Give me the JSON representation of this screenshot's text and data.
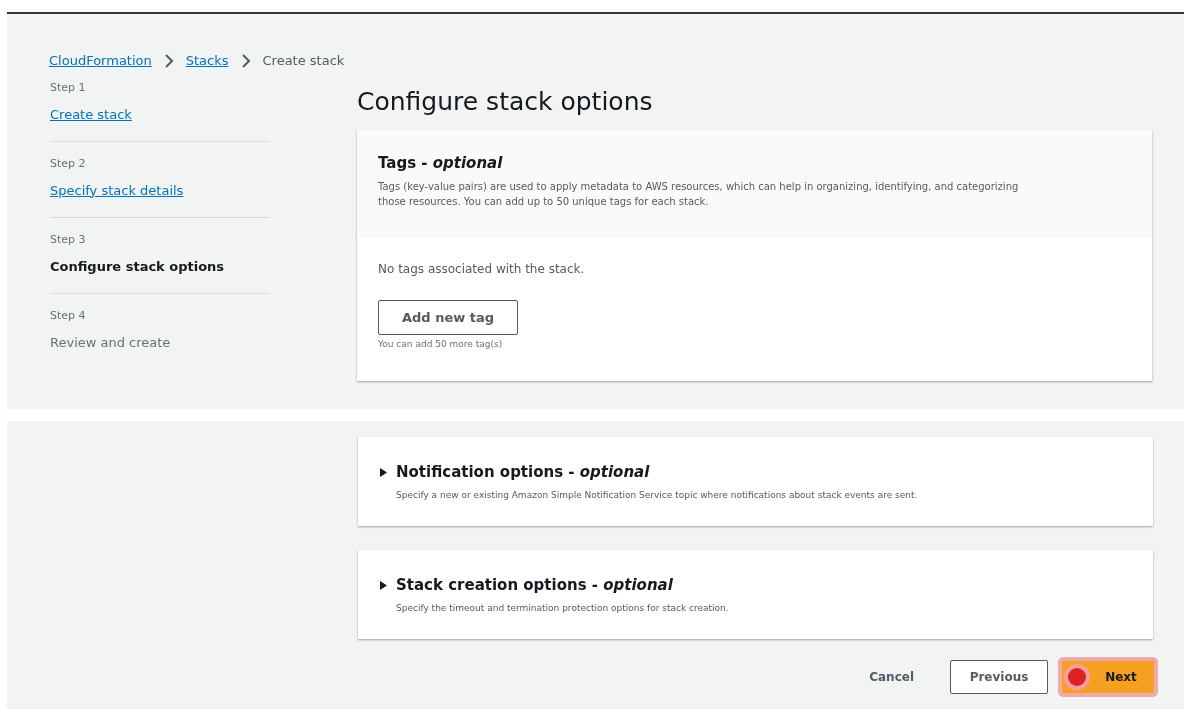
{
  "breadcrumb": [
    {
      "label": "CloudFormation",
      "kind": "link"
    },
    {
      "label": "Stacks",
      "kind": "link"
    },
    {
      "label": "Create stack",
      "kind": "current"
    }
  ],
  "steps": [
    {
      "step": "Step 1",
      "title": "Create stack",
      "kind": "link"
    },
    {
      "step": "Step 2",
      "title": "Specify stack details",
      "kind": "link"
    },
    {
      "step": "Step 3",
      "title": "Configure stack options",
      "kind": "current"
    },
    {
      "step": "Step 4",
      "title": "Review and create",
      "kind": "pending"
    }
  ],
  "heading": "Configure stack options",
  "tags_panel": {
    "title": "Tags - *optional*",
    "description": "Tags (key-value pairs) are used to apply metadata to AWS resources, which can help in organizing, identifying, and categorizing those resources. You can add up to 50 unique tags for each stack.",
    "empty_text": "No tags associated with the stack.",
    "add_button": "Add new tag",
    "hint": "You can add 50 more tag(s)"
  },
  "sections": [
    {
      "title": "Notification options - *optional*",
      "description": "Specify a new or existing Amazon Simple Notification Service topic where notifications about stack events are sent.",
      "expanded": false
    },
    {
      "title": "Stack creation options - *optional*",
      "description": "Specify the timeout and termination protection options for stack creation.",
      "expanded": false
    }
  ],
  "actions": [
    {
      "label": "Cancel",
      "kind": "link"
    },
    {
      "label": "Previous",
      "kind": "normal"
    },
    {
      "label": "Next",
      "kind": "primary",
      "clicked": true
    }
  ]
}
